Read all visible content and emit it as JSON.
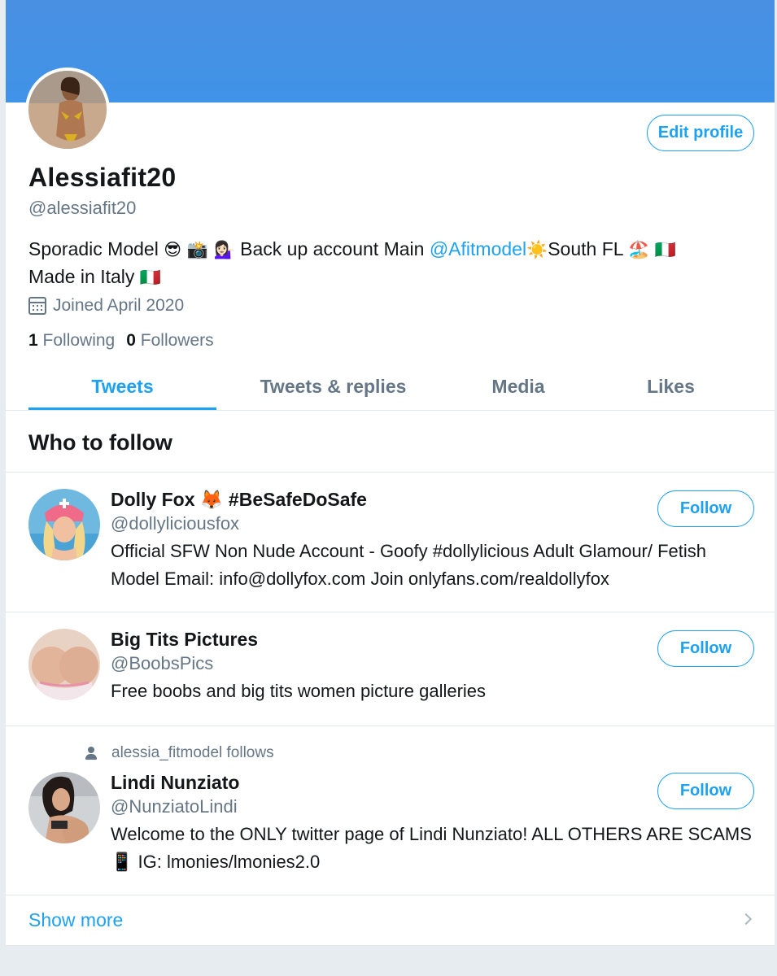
{
  "profile": {
    "display_name": "Alessiafit20",
    "handle": "@alessiafit20",
    "edit_label": "Edit profile",
    "bio_part1": "Sporadic Model ",
    "bio_emoji1": "😎 📸 💁🏻‍♀️",
    "bio_part2": " Back up account Main ",
    "bio_mention": "@Afitmodel",
    "bio_emoji2": " ☀️ ",
    "bio_part3": "South FL ",
    "bio_emoji3": "🏖️ 🇮🇹",
    "bio_part4": "Made in Italy ",
    "bio_emoji4": "🇮🇹",
    "joined": "Joined April 2020",
    "following_count": "1",
    "following_label": "Following",
    "followers_count": "0",
    "followers_label": "Followers"
  },
  "tabs": [
    "Tweets",
    "Tweets & replies",
    "Media",
    "Likes"
  ],
  "who_to_follow": {
    "title": "Who to follow",
    "follow_label": "Follow",
    "show_more": "Show more",
    "items": [
      {
        "name": "Dolly Fox 🦊 #BeSafeDoSafe",
        "handle": "@dollyliciousfox",
        "desc": "Official SFW Non Nude Account - Goofy #dollylicious Adult Glamour/ Fetish Model Email: info@dollyfox.com Join onlyfans.com/realdollyfox"
      },
      {
        "name": "Big Tits Pictures",
        "handle": "@BoobsPics",
        "desc": "Free boobs and big tits women picture galleries"
      },
      {
        "context": "alessia_fitmodel follows",
        "name": "Lindi Nunziato",
        "handle": "@NunziatoLindi",
        "desc": "Welcome to the ONLY twitter page of Lindi Nunziato! ALL OTHERS ARE SCAMS 📱 IG: lmonies/lmonies2.0"
      }
    ]
  },
  "colors": {
    "accent": "#1da1f2",
    "banner": "#4a90e2",
    "muted": "#657786"
  }
}
